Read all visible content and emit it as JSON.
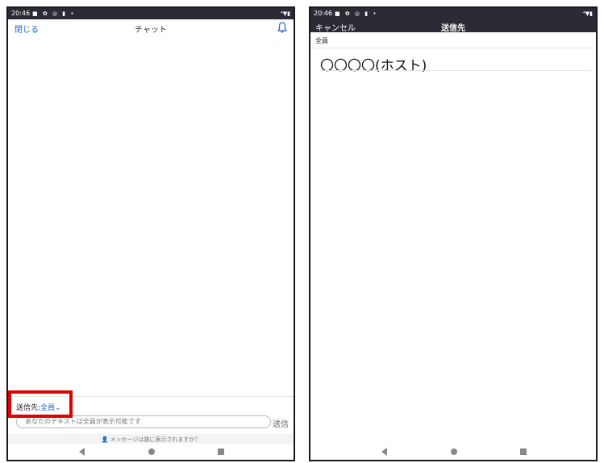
{
  "left_screen": {
    "status": {
      "time": "20:46",
      "icons": "■ ✿ ◎ ▮ •",
      "right_icons": "⁴▼▮"
    },
    "header": {
      "close_label": "閉じる",
      "title": "チャット"
    },
    "recipient": {
      "label": "送信先:",
      "value": "全員⌄"
    },
    "input": {
      "placeholder": "あなたのテキストは全員が表示可能です"
    },
    "send_label": "送信",
    "hint": "メッセージは誰に表示されますか？"
  },
  "right_screen": {
    "status": {
      "time": "20:46",
      "icons": "■ ✿ ◎ ▮ •",
      "right_icons": "⁴▼▮"
    },
    "header": {
      "cancel_label": "キャンセル",
      "title": "送信先"
    },
    "section_label": "全員",
    "items": [
      {
        "label": "〇〇〇〇(ホスト)"
      }
    ]
  },
  "colors": {
    "accent": "#1f63d6",
    "status_bar": "#2b2b35",
    "highlight": "#e10000"
  }
}
